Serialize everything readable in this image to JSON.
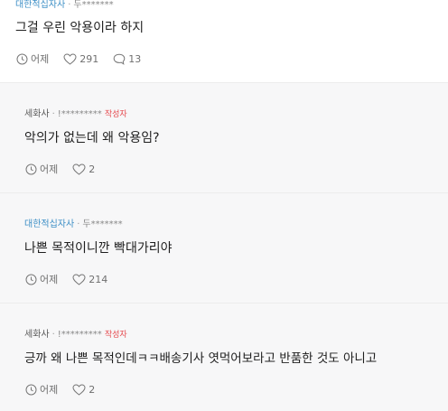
{
  "comments": [
    {
      "author": "대한적십자사",
      "writer": "두*******",
      "is_op": false,
      "text": "그걸 우린 악용이라 하지",
      "time": "어제",
      "likes": "291",
      "replies": "13"
    },
    {
      "author": "세화사",
      "writer": "!*********",
      "is_op": true,
      "op_badge": "작성자",
      "text": "악의가 없는데 왜 악용임?",
      "time": "어제",
      "likes": "2"
    },
    {
      "author": "대한적십자사",
      "writer": "두*******",
      "is_op": false,
      "text": "나쁜 목적이니깐 빡대가리야",
      "time": "어제",
      "likes": "214"
    },
    {
      "author": "세화사",
      "writer": "!*********",
      "is_op": true,
      "op_badge": "작성자",
      "text": "긍까 왜 나쁜 목적인데ㅋㅋ배송기사 엿먹어보라고 반품한 것도 아니고",
      "time": "어제",
      "likes": "2"
    }
  ],
  "colors": {
    "blue_author": "#3d8fc6",
    "op_badge": "#e5484d",
    "reply_bg": "#f7f7f8"
  },
  "icons": {
    "time": "clock-icon",
    "likes": "heart-icon",
    "replies": "speech-bubble-icon"
  }
}
